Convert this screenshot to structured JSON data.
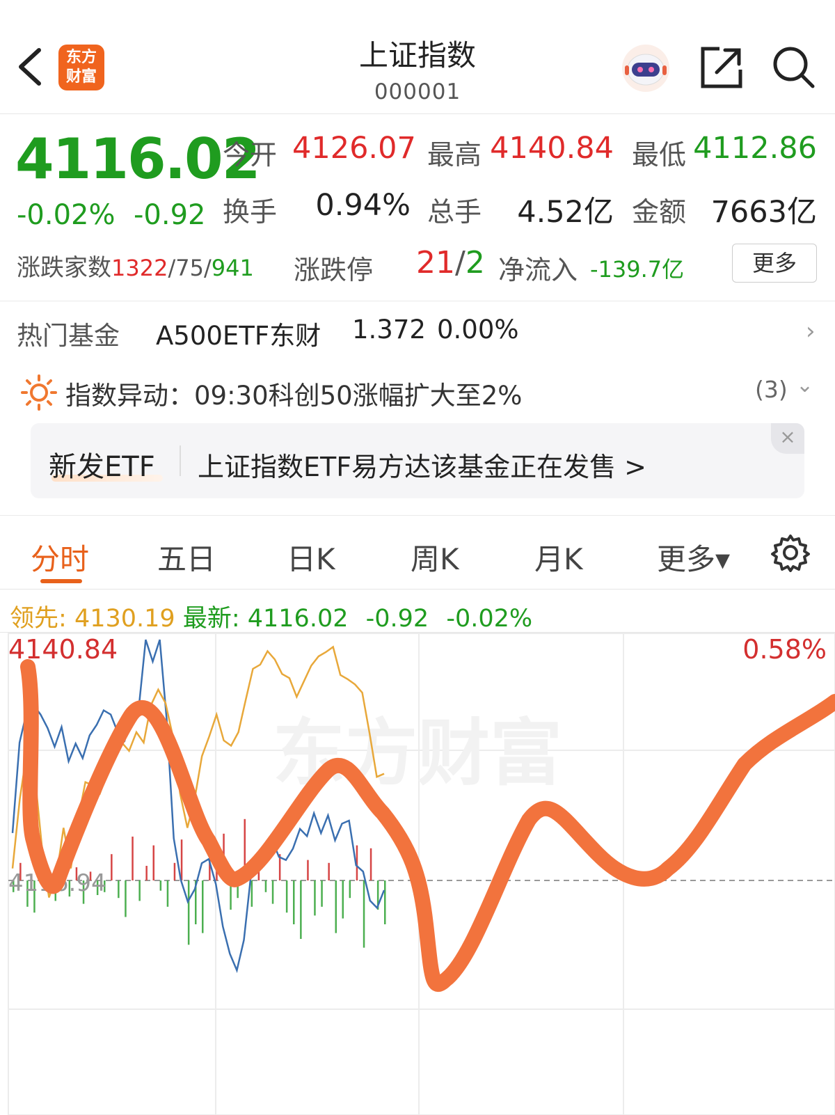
{
  "header": {
    "title": "上证指数",
    "code": "000001",
    "logo_line1": "东方",
    "logo_line2": "财富"
  },
  "quote": {
    "price": "4116.02",
    "change_pct": "-0.02%",
    "change": "-0.92",
    "stats": [
      {
        "label": "今开",
        "value": "4126.07",
        "color": "red"
      },
      {
        "label": "最高",
        "value": "4140.84",
        "color": "red"
      },
      {
        "label": "最低",
        "value": "4112.86",
        "color": "green"
      },
      {
        "label": "换手",
        "value": "0.94%",
        "color": "dark"
      },
      {
        "label": "总手",
        "value": "4.52亿",
        "color": "dark"
      },
      {
        "label": "金额",
        "value": "7663亿",
        "color": "dark"
      }
    ],
    "breadth_label": "涨跌家数",
    "breadth_up": "1322",
    "breadth_flat": "75",
    "breadth_down": "941",
    "limit_label": "涨跌停",
    "limit_up": "21",
    "limit_down": "2",
    "flow_label": "净流入",
    "flow_value": "-139.7亿",
    "more": "更多"
  },
  "hot_fund": {
    "label": "热门基金",
    "name": "A500ETF东财",
    "price": "1.372",
    "change": "0.00%"
  },
  "alert": {
    "text": "指数异动：09:30科创50涨幅扩大至2%",
    "count": "(3)"
  },
  "banner": {
    "tag": "新发ETF",
    "text": "上证指数ETF易方达该基金正在发售 >",
    "close": "×"
  },
  "tabs": [
    "分时",
    "五日",
    "日K",
    "周K",
    "月K",
    "更多▾"
  ],
  "chart_legend": {
    "lead_label": "领先:",
    "lead_value": "4130.19",
    "last_label": "最新:",
    "last_value": "4116.02",
    "last_change": "-0.92",
    "last_pct": "-0.02%"
  },
  "chart_data": {
    "type": "line",
    "y_top_label": "4140.84",
    "y_top_pct": "0.58%",
    "baseline_label": "4116.94",
    "baseline": 4116.94,
    "ylim": [
      4093.04,
      4140.84
    ],
    "watermark": "东方财富",
    "series": [
      {
        "name": "最新",
        "color": "#3a6fb0",
        "values": [
          4121.5,
          4130.2,
          4133.1,
          4133.8,
          4132.9,
          4131.6,
          4129.8,
          4131.7,
          4128.4,
          4130.1,
          4128.7,
          4130.9,
          4131.9,
          4133.3,
          4132.9,
          4131.2,
          4130.4,
          4133.0,
          4133.5,
          4140.1,
          4138.0,
          4140.1,
          4132.3,
          4121.0,
          4117.0,
          4114.9,
          4116.1,
          4118.6,
          4119.0,
          4116.6,
          4112.5,
          4109.9,
          4108.3,
          4111.2,
          4117.4,
          4118.2,
          4119.0,
          4120.9,
          4119.2,
          4118.9,
          4120.0,
          4121.9,
          4121.2,
          4123.4,
          4121.5,
          4123.2,
          4120.8,
          4122.4,
          4122.7,
          4118.4,
          4117.8,
          4115.0,
          4114.3,
          4116.0
        ]
      },
      {
        "name": "领先",
        "color": "#e8a83a",
        "values": [
          4118.1,
          4124.8,
          4129.4,
          4127.5,
          4120.4,
          4115.3,
          4117.2,
          4122.0,
          4118.1,
          4122.8,
          4126.4,
          4126.1,
          4125.3,
          4127.2,
          4129.1,
          4130.2,
          4129.4,
          4131.2,
          4130.2,
          4133.8,
          4135.3,
          4134.0,
          4130.8,
          4125.3,
          4122.0,
          4124.8,
          4128.9,
          4130.8,
          4132.9,
          4130.4,
          4129.9,
          4131.2,
          4134.3,
          4137.3,
          4137.7,
          4139.0,
          4138.2,
          4136.8,
          4136.4,
          4134.6,
          4136.1,
          4137.6,
          4138.5,
          4138.9,
          4139.4,
          4136.7,
          4136.3,
          4135.8,
          4135.0,
          4131.1,
          4126.9,
          4127.2
        ]
      }
    ],
    "volume_bars": [
      -8,
      12,
      -18,
      -22,
      15,
      -9,
      -14,
      20,
      -11,
      9,
      -16,
      6,
      -10,
      -8,
      18,
      -12,
      -25,
      30,
      -14,
      10,
      24,
      -7,
      -18,
      12,
      28,
      -44,
      -30,
      -36,
      16,
      22,
      32,
      -20,
      -12,
      42,
      -18,
      10,
      -8,
      -16,
      18,
      -22,
      -30,
      -40,
      14,
      -24,
      -18,
      12,
      -36,
      -26,
      -12,
      24,
      -46,
      22,
      -20,
      -30
    ]
  }
}
